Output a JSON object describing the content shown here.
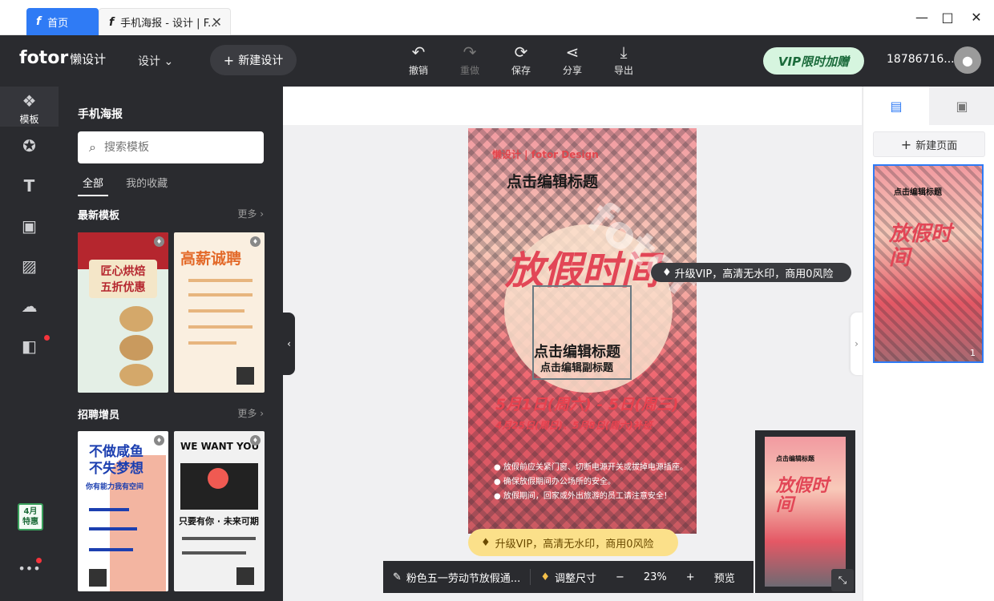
{
  "titlebar": {
    "tabs": [
      {
        "label": "首页"
      },
      {
        "label": "手机海报 - 设计 | F..."
      }
    ],
    "controls": {
      "minimize": "—",
      "maximize": "□",
      "close": "✕"
    }
  },
  "toolbar": {
    "logo": "fotor",
    "logo_sub": "懒设计",
    "design_menu": "设计",
    "new_design": "新建设计",
    "actions": [
      {
        "label": "撤销",
        "icon": "undo-icon",
        "enabled": true
      },
      {
        "label": "重做",
        "icon": "redo-icon",
        "enabled": false
      },
      {
        "label": "保存",
        "icon": "save-icon",
        "enabled": true
      },
      {
        "label": "分享",
        "icon": "share-icon",
        "enabled": true
      },
      {
        "label": "导出",
        "icon": "export-icon",
        "enabled": true
      }
    ],
    "vip_button": "VIP限时加赠",
    "user_id": "18786716..."
  },
  "rail": {
    "items": [
      {
        "label": "模板",
        "icon": "layers-icon"
      },
      {
        "icon": "star-icon"
      },
      {
        "icon": "text-icon"
      },
      {
        "icon": "image-icon"
      },
      {
        "icon": "texture-icon"
      },
      {
        "icon": "upload-icon"
      },
      {
        "icon": "apps-icon"
      }
    ],
    "calendar_badge": {
      "month": "4月",
      "label": "特惠"
    },
    "more": "•••"
  },
  "panel": {
    "title": "手机海报",
    "search_placeholder": "搜索模板",
    "tabs": [
      "全部",
      "我的收藏"
    ],
    "sections": [
      {
        "title": "最新模板",
        "more": "更多",
        "templates": [
          {
            "t1": "匠心烘焙",
            "t2": "五折优惠"
          },
          {
            "t1": "高薪诚聘",
            "t2": ""
          }
        ]
      },
      {
        "title": "招聘增员",
        "more": "更多",
        "templates": [
          {
            "t1": "不做咸鱼",
            "t2": "不失梦想",
            "t3": "你有能力我有空间"
          },
          {
            "t1": "WE WANT YOU",
            "t2": "只要有你 · 未来可期"
          }
        ]
      }
    ]
  },
  "poster": {
    "brand": "懒设计 | fotor Design",
    "title": "点击编辑标题",
    "big_text": "放假时间",
    "title2": "点击编辑标题",
    "subtitle": "点击编辑副标题",
    "date_main": "5月1日(周六) - 5日(周三)",
    "date_sub": "4月25日(周日)、5月8日(周六)补班",
    "bullets": [
      "放假前应关紧门窗、切断电源开关或拔掉电源插座。",
      "确保放假期间办公场所的安全。",
      "放假期间，回家或外出旅游的员工请注意安全！"
    ],
    "watermark": "fotor"
  },
  "vip_tip": "升级VIP，高清无水印，商用0风险",
  "vip_bottom": "升级VIP，高清无水印，商用0风险",
  "bottombar": {
    "doc_name": "粉色五一劳动节放假通...",
    "resize": "调整尺寸",
    "zoom_out": "−",
    "zoom": "23%",
    "zoom_in": "+",
    "preview": "预览"
  },
  "rpanel": {
    "new_page": "新建页面",
    "page_number": "1",
    "thumb_title": "点击编辑标题",
    "thumb_big": "放假时间"
  },
  "colors": {
    "dark": "#2a2b2f",
    "accent": "#2f7bf5",
    "poster_red": "#e24656",
    "vip_green": "#d6f5df"
  }
}
